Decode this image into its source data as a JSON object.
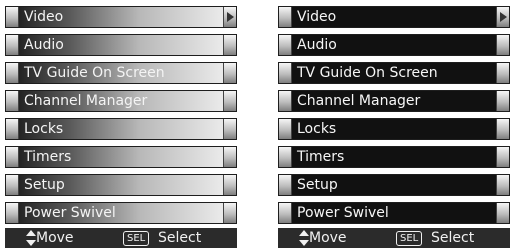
{
  "menu": {
    "items": [
      {
        "label": "Video",
        "expandable": true
      },
      {
        "label": "Audio",
        "expandable": false
      },
      {
        "label": "TV Guide On Screen",
        "expandable": false
      },
      {
        "label": "Channel Manager",
        "expandable": false
      },
      {
        "label": "Locks",
        "expandable": false
      },
      {
        "label": "Timers",
        "expandable": false
      },
      {
        "label": "Setup",
        "expandable": false
      },
      {
        "label": "Power Swivel",
        "expandable": false
      }
    ]
  },
  "footer": {
    "move_label": "Move",
    "sel_badge": "SEL",
    "select_label": "Select"
  },
  "icons": {
    "expand": "chevron-right-icon",
    "move": "up-down-arrows-icon"
  },
  "colors": {
    "dark_item": "#111111",
    "footer_bg": "#2b2b2b",
    "text": "#f4f4f4"
  }
}
